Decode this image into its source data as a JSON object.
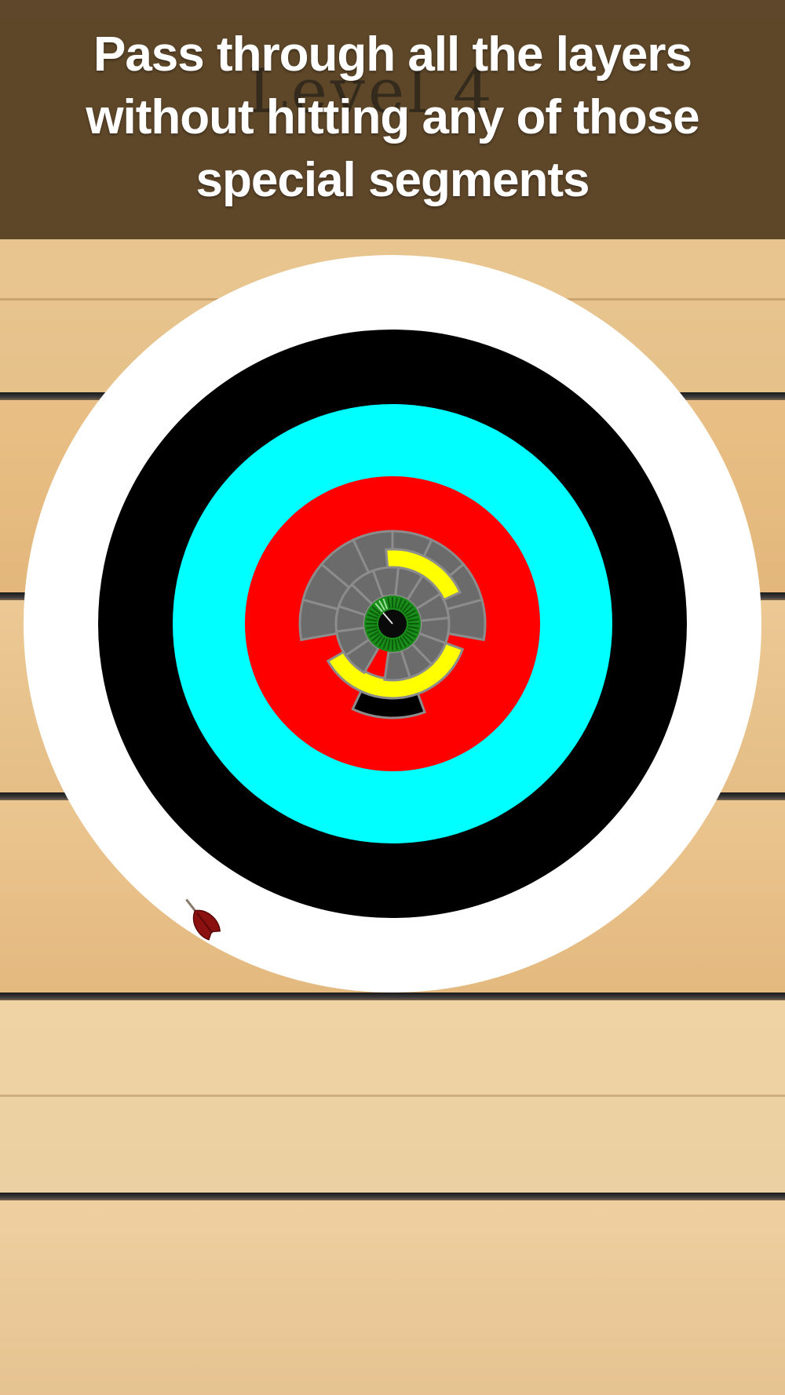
{
  "game": {
    "instruction": "Pass through all the layers without hitting any of those special segments",
    "background_level_label": "Level 4"
  },
  "colors": {
    "wood_light": "#ecc995",
    "wood_dark_gap": "#1e1e1e",
    "banner_overlay": "#4a341a",
    "ring_white": "#ffffff",
    "ring_black": "#000000",
    "ring_cyan": "#00ffff",
    "ring_red": "#ff0000",
    "segment_gray": "#6b6b6b",
    "segment_yellow": "#ffff00",
    "core_green": "#1a8c1a",
    "dart_red": "#8b1010"
  },
  "target": {
    "rings": [
      "white",
      "black",
      "cyan",
      "red"
    ],
    "inner_layers": [
      "gray-segments-outer",
      "yellow-arc",
      "gray-segments-inner",
      "green-core"
    ],
    "darts_on_board": 1
  }
}
